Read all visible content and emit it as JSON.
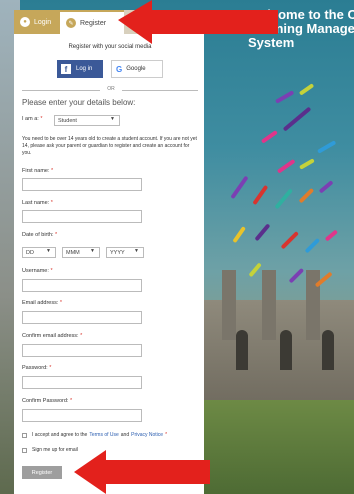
{
  "tabs": {
    "login": "Login",
    "register": "Register"
  },
  "welcome": {
    "line1": "Welcome to the C",
    "line2": "Learning Manage",
    "line3": "System"
  },
  "social": {
    "text": "Register with your social media",
    "facebook": "Log in",
    "google": "Google"
  },
  "or_text": "OR",
  "heading": "Please enter your details below:",
  "iam": {
    "label": "I am a:",
    "value": "Student"
  },
  "note": "You need to be over 14 years old to create a student account. If you are not yet 14, please ask your parent or guardian to register and create an account for you.",
  "fields": {
    "first_name": "First name:",
    "last_name": "Last name:",
    "dob": "Date of birth:",
    "dob_dd": "DD",
    "dob_mm": "MMM",
    "dob_yyyy": "YYYY",
    "username": "Username:",
    "email": "Email address:",
    "confirm_email": "Confirm email address:",
    "password": "Password:",
    "confirm_password": "Confirm Password:",
    "required_mark": "*"
  },
  "consent": {
    "prefix": "I accept and agree to the",
    "terms": "Terms of Use",
    "and": "and",
    "privacy": "Privacy Notice",
    "signup": "Sign me up for email"
  },
  "register_button": "Register",
  "colors": {
    "accent_gold": "#c6a75a",
    "facebook": "#3b5998",
    "arrow_red": "#e3211c"
  },
  "icons": {
    "login_tab": "lock-icon",
    "register_tab": "pencil-icon",
    "facebook": "facebook-logo-icon",
    "google": "google-logo-icon"
  }
}
